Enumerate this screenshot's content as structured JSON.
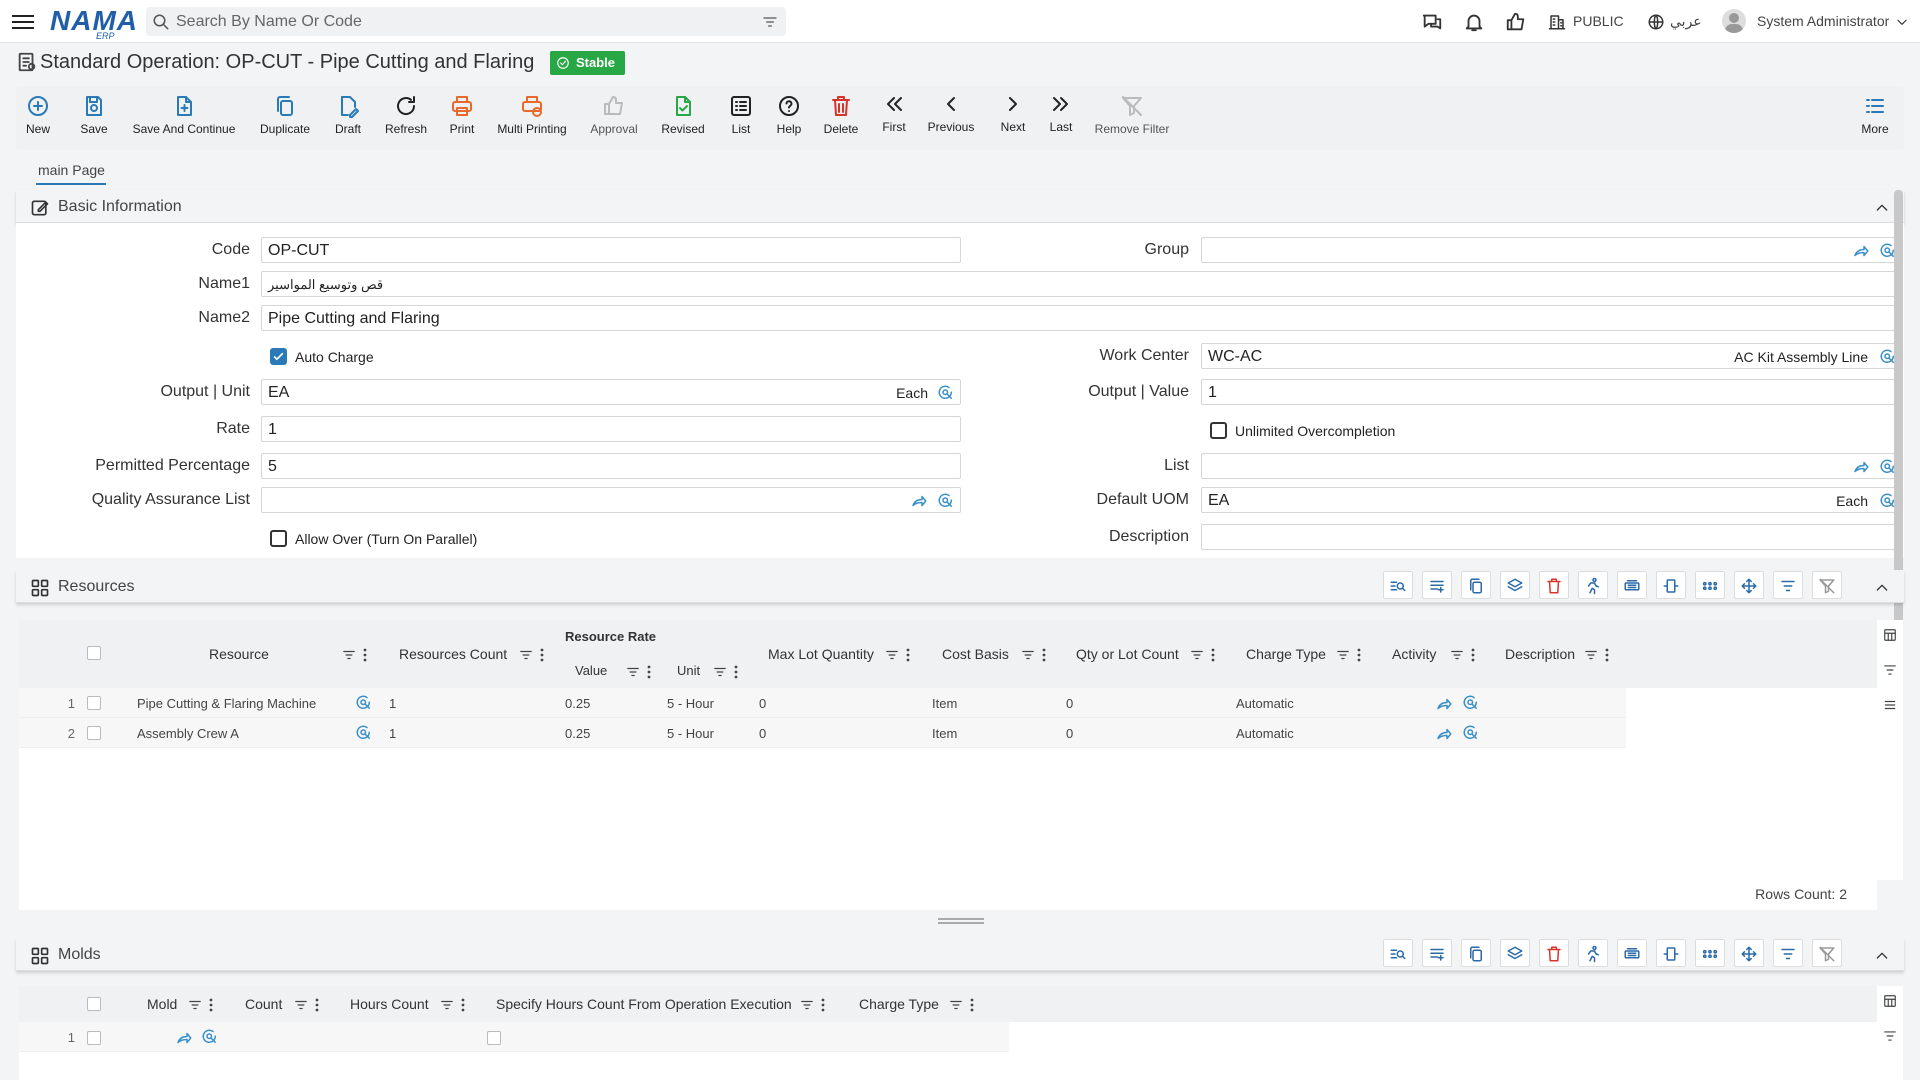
{
  "topbar": {
    "logo": "NAMA",
    "logo_sub": "ERP",
    "search_placeholder": "Search By Name Or Code",
    "public_label": "PUBLIC",
    "lang_label": "عربي",
    "user_name": "System Administrator"
  },
  "page": {
    "title": "Standard Operation: OP-CUT - Pipe Cutting and Flaring",
    "status": "Stable"
  },
  "toolbar": {
    "new": "New",
    "save": "Save",
    "save_continue": "Save And Continue",
    "duplicate": "Duplicate",
    "draft": "Draft",
    "refresh": "Refresh",
    "print": "Print",
    "multi_printing": "Multi Printing",
    "approval": "Approval",
    "revised": "Revised",
    "list": "List",
    "help": "Help",
    "delete": "Delete",
    "first": "First",
    "previous": "Previous",
    "next": "Next",
    "last": "Last",
    "remove_filter": "Remove Filter",
    "more": "More"
  },
  "tabs": {
    "main": "main Page"
  },
  "basic": {
    "section_title": "Basic Information",
    "code_label": "Code",
    "code_value": "OP-CUT",
    "name1_label": "Name1",
    "name1_value": "قص وتوسيع المواسير",
    "name2_label": "Name2",
    "name2_value": "Pipe Cutting and Flaring",
    "auto_charge_label": "Auto Charge",
    "auto_charge": true,
    "output_unit_label": "Output | Unit",
    "output_unit_value": "EA",
    "output_unit_name": "Each",
    "rate_label": "Rate",
    "rate_value": "1",
    "permitted_label": "Permitted Percentage",
    "permitted_value": "5",
    "qa_list_label": "Quality Assurance List",
    "qa_list_value": "",
    "allow_over_label": "Allow Over (Turn On Parallel)",
    "allow_over": false,
    "group_label": "Group",
    "group_value": "",
    "work_center_label": "Work Center",
    "work_center_value": "WC-AC",
    "work_center_name": "AC Kit Assembly Line",
    "output_value_label": "Output | Value",
    "output_value_value": "1",
    "unlimited_label": "Unlimited Overcompletion",
    "unlimited": false,
    "list_label": "List",
    "list_value": "",
    "default_uom_label": "Default UOM",
    "default_uom_value": "EA",
    "default_uom_name": "Each",
    "description_label": "Description",
    "description_value": ""
  },
  "resources": {
    "section_title": "Resources",
    "headers": {
      "resource": "Resource",
      "count": "Resources Count",
      "rate_group": "Resource Rate",
      "value": "Value",
      "unit": "Unit",
      "max_lot": "Max Lot Quantity",
      "cost_basis": "Cost Basis",
      "qty_lot": "Qty or Lot Count",
      "charge_type": "Charge Type",
      "activity": "Activity",
      "description": "Description"
    },
    "rows": [
      {
        "n": "1",
        "resource": "Pipe Cutting & Flaring Machine",
        "count": "1",
        "value": "0.25",
        "unit": "5 - Hour",
        "max_lot": "0",
        "cost_basis": "Item",
        "qty_lot": "0",
        "charge_type": "Automatic"
      },
      {
        "n": "2",
        "resource": "Assembly Crew A",
        "count": "1",
        "value": "0.25",
        "unit": "5 - Hour",
        "max_lot": "0",
        "cost_basis": "Item",
        "qty_lot": "0",
        "charge_type": "Automatic"
      }
    ],
    "rows_count": "Rows Count: 2"
  },
  "molds": {
    "section_title": "Molds",
    "headers": {
      "mold": "Mold",
      "count": "Count",
      "hours_count": "Hours Count",
      "specify_hours": "Specify Hours Count From Operation Execution",
      "charge_type": "Charge Type"
    },
    "rows": [
      {
        "n": "1"
      }
    ]
  },
  "colors": {
    "accent": "#2a7ab8",
    "status_green": "#28a745",
    "print_orange": "#e8692c",
    "delete_red": "#d9342b"
  }
}
